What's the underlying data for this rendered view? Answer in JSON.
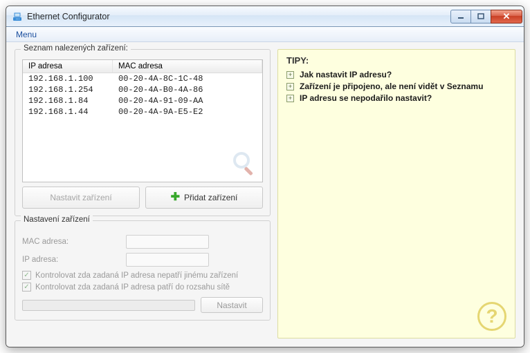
{
  "window": {
    "title": "Ethernet Configurator"
  },
  "menu": {
    "label": "Menu"
  },
  "devices": {
    "legend": "Seznam nalezených zařízení:",
    "columns": {
      "ip": "IP adresa",
      "mac": "MAC adresa"
    },
    "rows": [
      {
        "ip": "192.168.1.100",
        "mac": "00-20-4A-8C-1C-48"
      },
      {
        "ip": "192.168.1.254",
        "mac": "00-20-4A-B0-4A-86"
      },
      {
        "ip": "192.168.1.84",
        "mac": "00-20-4A-91-09-AA"
      },
      {
        "ip": "192.168.1.44",
        "mac": "00-20-4A-9A-E5-E2"
      }
    ],
    "btn_configure": "Nastavit zařízení",
    "btn_add": "Přidat zařízení"
  },
  "settings": {
    "legend": "Nastavení zařízení",
    "mac_label": "MAC adresa:",
    "ip_label": "IP adresa:",
    "chk1": "Kontrolovat zda zadaná IP adresa nepatří jinému zařízení",
    "chk2": "Kontrolovat zda zadaná IP adresa patří do rozsahu sítě",
    "btn_set": "Nastavit"
  },
  "tips": {
    "title": "TIPY:",
    "items": [
      "Jak nastavit IP adresu?",
      "Zařízení je připojeno, ale není vidět v Seznamu",
      "IP adresu se nepodařilo nastavit?"
    ]
  }
}
